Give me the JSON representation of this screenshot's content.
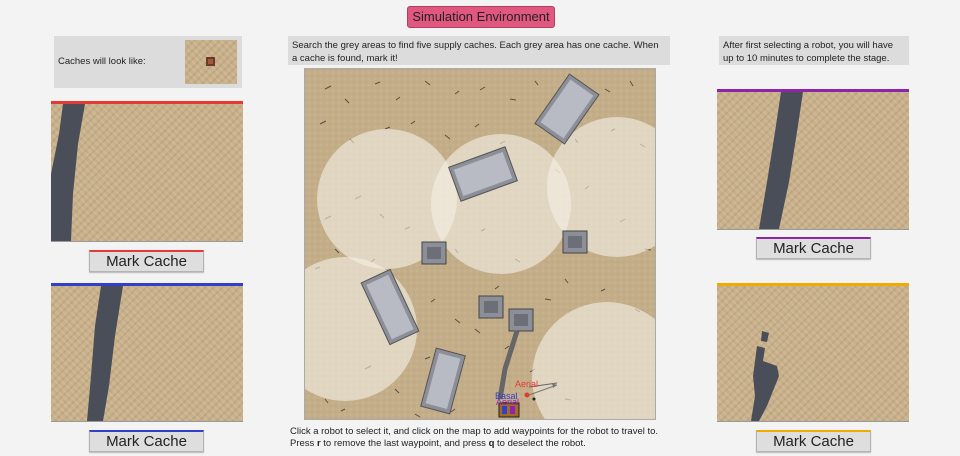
{
  "title": "Simulation Environment",
  "cache_preview": {
    "label": "Caches will look like:"
  },
  "top_info": "Search the grey areas to find five supply caches. Each grey area has one cache. When a cache is found, mark it!",
  "timer_info": "After first selecting a robot, you will have up to 10 minutes to complete the stage.",
  "robots": [
    {
      "name": "feed-red",
      "color": "#e53935",
      "button": "Mark Cache"
    },
    {
      "name": "feed-blue",
      "color": "#3040c8",
      "button": "Mark Cache"
    },
    {
      "name": "feed-purple",
      "color": "#8e24aa",
      "button": "Mark Cache"
    },
    {
      "name": "feed-orange",
      "color": "#f2a900",
      "button": "Mark Cache"
    }
  ],
  "map": {
    "robot_labels": {
      "aerial": "Aerial",
      "ground_1": "Basal",
      "ground_2": "Aerial"
    }
  },
  "instructions": {
    "line1": "Click a robot to select it, and click on the map to add waypoints for the robot to travel to.",
    "line2_a": "Press ",
    "key_r": "r",
    "line2_b": " to remove the last waypoint, and press ",
    "key_q": "q",
    "line2_c": " to deselect the robot."
  }
}
